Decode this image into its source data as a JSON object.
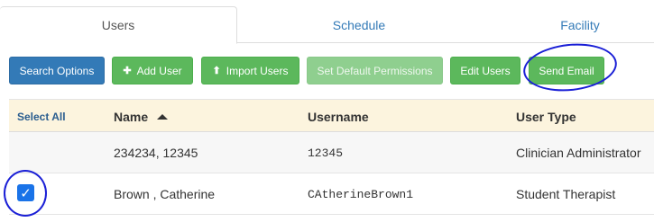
{
  "tabs": [
    {
      "label": "Users",
      "active": true
    },
    {
      "label": "Schedule",
      "active": false
    },
    {
      "label": "Facility",
      "active": false
    }
  ],
  "toolbar": {
    "search_options": "Search Options",
    "add_user": "Add User",
    "import_users": "Import Users",
    "set_default_permissions": "Set Default Permissions",
    "edit_users": "Edit Users",
    "send_email": "Send Email"
  },
  "table": {
    "headers": {
      "select_all": "Select All",
      "name": "Name",
      "username": "Username",
      "user_type": "User Type"
    },
    "rows": [
      {
        "selected": false,
        "name": "234234, 12345",
        "username": "12345",
        "user_type": "Clinician Administrator"
      },
      {
        "selected": true,
        "name": "Brown , Catherine",
        "username": "CAtherineBrown1",
        "user_type": "Student Therapist"
      }
    ]
  },
  "colors": {
    "primary": "#337ab7",
    "success": "#5cb85c",
    "header_bg": "#fcf4de",
    "annotation": "#1a1fd6",
    "checkbox": "#1a73e8"
  }
}
